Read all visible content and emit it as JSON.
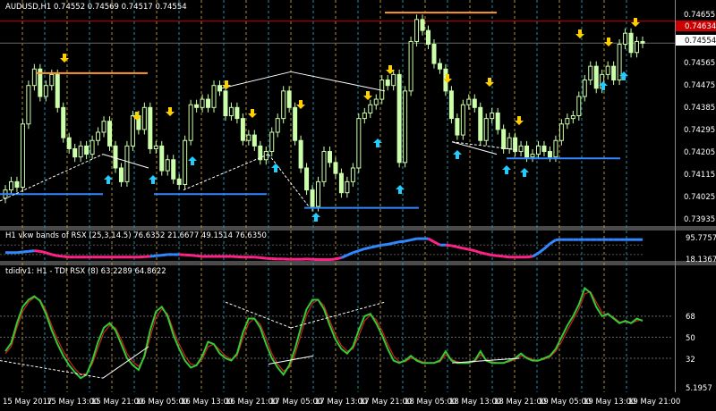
{
  "main": {
    "symbol_line": "AUDUSD,H1  0.74552 0.74569 0.74517 0.74554",
    "price_ticks": [
      "0.74655",
      "0.74565",
      "0.74475",
      "0.74385",
      "0.74295",
      "0.74205",
      "0.74115",
      "0.74025",
      "0.73935"
    ],
    "badge_red": "0.74634",
    "badge_white": "0.74554"
  },
  "ind1": {
    "label": "H1 vkw bands of RSX (25,3,14.5) 76.6352 21.6677 49.1514 76.6350",
    "ticks": [
      "95.7757",
      "18.1367"
    ]
  },
  "ind2": {
    "label": "tdidiv1: H1 - TDI RSX (8) 63.2289 64.8622",
    "ticks": [
      "68",
      "50",
      "32",
      "5.1957"
    ]
  },
  "time_labels": [
    "15 May 2017",
    "15 May 13:00",
    "15 May 21:00",
    "16 May 05:00",
    "16 May 13:00",
    "16 May 21:00",
    "17 May 05:00",
    "17 May 13:00",
    "17 May 21:00",
    "18 May 05:00",
    "18 May 13:00",
    "18 May 21:00",
    "19 May 05:00",
    "19 May 13:00",
    "19 May 21:00"
  ],
  "colors": {
    "background": "#000000",
    "candle": "#ccffaa",
    "up_arrow": "#22ccff",
    "down_arrow": "#ffd000",
    "support": "#3388ff",
    "resistance": "#ff9933",
    "ask_line": "#cc0000",
    "band_up": "#3388ff",
    "band_down": "#ff2288",
    "tdi_fast": "#33cc33",
    "tdi_slow": "#cc2222"
  },
  "chart_data": {
    "type": "candlestick",
    "symbol": "AUDUSD",
    "timeframe": "H1",
    "ylim": [
      0.73905,
      0.74685
    ],
    "closes": [
      0.7402,
      0.7405,
      0.7403,
      0.7426,
      0.744,
      0.7446,
      0.7436,
      0.744,
      0.7444,
      0.7432,
      0.7421,
      0.7417,
      0.7414,
      0.7418,
      0.7415,
      0.742,
      0.7423,
      0.7427,
      0.7418,
      0.741,
      0.7405,
      0.7418,
      0.7429,
      0.7424,
      0.7432,
      0.7417,
      0.7418,
      0.7409,
      0.7413,
      0.7406,
      0.7404,
      0.742,
      0.7433,
      0.7432,
      0.7435,
      0.7432,
      0.744,
      0.7438,
      0.7429,
      0.7432,
      0.7428,
      0.742,
      0.7422,
      0.7418,
      0.7413,
      0.7416,
      0.7423,
      0.7428,
      0.7438,
      0.7432,
      0.742,
      0.741,
      0.7402,
      0.7396,
      0.7405,
      0.7416,
      0.7412,
      0.7408,
      0.7401,
      0.7405,
      0.741,
      0.7428,
      0.743,
      0.7433,
      0.7435,
      0.7442,
      0.744,
      0.7444,
      0.7412,
      0.7438,
      0.7456,
      0.7464,
      0.746,
      0.7455,
      0.7448,
      0.7446,
      0.7438,
      0.7428,
      0.7422,
      0.7433,
      0.7435,
      0.7432,
      0.742,
      0.7428,
      0.743,
      0.7424,
      0.7417,
      0.7421,
      0.7416,
      0.7418,
      0.7414,
      0.7415,
      0.7418,
      0.7416,
      0.7414,
      0.742,
      0.7426,
      0.7428,
      0.7429,
      0.7436,
      0.7442,
      0.7447,
      0.7439,
      0.7444,
      0.7447,
      0.7442,
      0.7455,
      0.7459,
      0.7452,
      0.7456,
      0.74554
    ],
    "support_levels": [
      0.74005,
      0.74005,
      0.73955,
      0.74135
    ],
    "resistance_levels": [
      0.74445,
      0.74665
    ],
    "bands_rsx": {
      "ylim": [
        10,
        100
      ],
      "values": [
        36,
        36,
        36,
        38,
        40,
        42,
        40,
        36,
        30,
        26,
        24,
        22,
        22,
        22,
        22,
        22,
        22,
        22,
        22,
        22,
        22,
        22,
        22,
        22,
        23,
        24,
        26,
        28,
        30,
        30,
        30,
        29,
        28,
        26,
        24,
        24,
        24,
        24,
        24,
        24,
        23,
        22,
        22,
        22,
        20,
        18,
        17,
        16,
        16,
        15,
        15,
        15,
        16,
        15,
        14,
        14,
        14,
        16,
        20,
        28,
        36,
        42,
        48,
        52,
        56,
        60,
        62,
        66,
        70,
        72,
        76,
        80,
        80,
        80,
        70,
        60,
        60,
        58,
        54,
        50,
        46,
        42,
        36,
        32,
        28,
        26,
        24,
        22,
        22,
        22,
        22,
        24,
        34,
        48,
        64,
        76,
        77,
        77,
        77,
        77,
        77,
        77,
        77,
        77,
        77,
        77,
        77,
        77,
        77,
        77,
        77
      ]
    },
    "tdi_rsx": {
      "ylim": [
        5.1957,
        100
      ],
      "fast": [
        38,
        45,
        62,
        76,
        82,
        85,
        81,
        70,
        56,
        44,
        34,
        26,
        20,
        15,
        18,
        30,
        46,
        58,
        62,
        56,
        44,
        32,
        26,
        22,
        34,
        56,
        72,
        76,
        68,
        52,
        40,
        30,
        24,
        26,
        34,
        46,
        44,
        36,
        32,
        30,
        36,
        54,
        66,
        66,
        58,
        44,
        32,
        24,
        18,
        26,
        40,
        58,
        74,
        82,
        82,
        74,
        60,
        48,
        40,
        36,
        42,
        56,
        68,
        70,
        62,
        52,
        40,
        30,
        28,
        30,
        34,
        30,
        28,
        28,
        28,
        30,
        38,
        30,
        28,
        28,
        28,
        30,
        38,
        30,
        28,
        28,
        28,
        30,
        32,
        36,
        32,
        30,
        30,
        32,
        34,
        40,
        50,
        60,
        68,
        78,
        92,
        88,
        76,
        68,
        70,
        66,
        62,
        64,
        62,
        66,
        64
      ],
      "slow": [
        36,
        42,
        58,
        72,
        80,
        84,
        82,
        73,
        60,
        48,
        38,
        30,
        23,
        18,
        19,
        27,
        41,
        54,
        60,
        58,
        48,
        36,
        29,
        25,
        32,
        50,
        67,
        74,
        70,
        56,
        44,
        34,
        27,
        26,
        31,
        42,
        44,
        39,
        34,
        31,
        34,
        49,
        62,
        66,
        61,
        49,
        36,
        27,
        21,
        24,
        35,
        52,
        69,
        79,
        82,
        77,
        64,
        52,
        43,
        38,
        40,
        51,
        64,
        69,
        65,
        56,
        44,
        34,
        29,
        29,
        32,
        31,
        29,
        28,
        28,
        29,
        35,
        31,
        29,
        28,
        28,
        29,
        35,
        31,
        29,
        28,
        28,
        29,
        31,
        34,
        33,
        31,
        30,
        31,
        33,
        38,
        46,
        56,
        65,
        74,
        87,
        89,
        80,
        71,
        69,
        67,
        63,
        63,
        62,
        64,
        65
      ]
    }
  }
}
